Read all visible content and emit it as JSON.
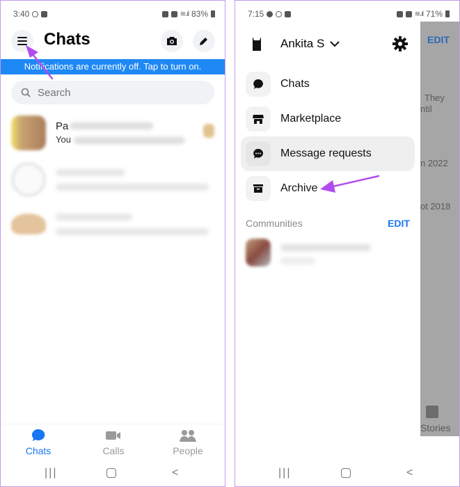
{
  "left": {
    "status": {
      "time": "3:40",
      "battery": "83%"
    },
    "header": {
      "title": "Chats"
    },
    "notification_bar": "Notifications are currently off. Tap to turn on.",
    "search": {
      "placeholder": "Search"
    },
    "chats": [
      {
        "name_visible": "Pa",
        "preview_visible": "You",
        "avatar_color": "#c9a173"
      },
      {
        "name_visible": "",
        "preview_visible": "",
        "avatar_color": "#e8e8e8"
      },
      {
        "name_visible": "",
        "preview_visible": "",
        "avatar_color": "#e4c49c"
      }
    ],
    "bottom_nav": [
      {
        "label": "Chats",
        "icon": "chat-bubble-icon",
        "active": true
      },
      {
        "label": "Calls",
        "icon": "video-camera-icon",
        "active": false
      },
      {
        "label": "People",
        "icon": "people-icon",
        "active": false
      }
    ]
  },
  "right": {
    "status": {
      "time": "7:15",
      "battery": "71%"
    },
    "drawer": {
      "user_name": "Ankita S",
      "menu": [
        {
          "label": "Chats",
          "icon": "chat-bubble-icon",
          "highlighted": false
        },
        {
          "label": "Marketplace",
          "icon": "storefront-icon",
          "highlighted": false
        },
        {
          "label": "Message requests",
          "icon": "message-requests-icon",
          "highlighted": true
        },
        {
          "label": "Archive",
          "icon": "archive-box-icon",
          "highlighted": false
        }
      ],
      "communities_label": "Communities",
      "communities_edit": "EDIT"
    },
    "background": {
      "edit": "EDIT",
      "snippet_1": "They",
      "snippet_2": "ntil",
      "snippet_3": "n 2022",
      "snippet_4": "ot 2018",
      "stories": "Stories"
    }
  },
  "colors": {
    "accent": "#1877f2",
    "notification_bar": "#1e88f5",
    "annotation_arrow": "#b04cf0"
  }
}
